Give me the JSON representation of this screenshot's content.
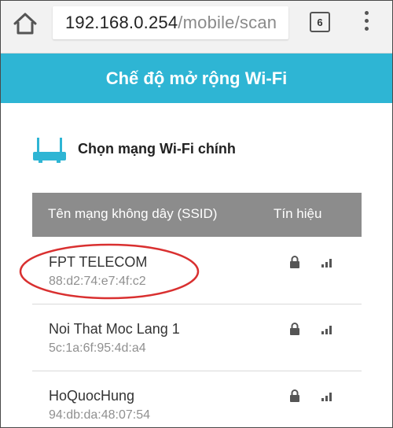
{
  "browser": {
    "url_host": "192.168.0.254",
    "url_path": "/mobile/scan",
    "tab_count": "6"
  },
  "header": {
    "title": "Chế độ mở rộng Wi-Fi"
  },
  "section": {
    "title": "Chọn mạng Wi-Fi chính"
  },
  "table": {
    "col_ssid": "Tên mạng không dây (SSID)",
    "col_signal": "Tín hiệu",
    "rows": [
      {
        "ssid": "FPT TELECOM",
        "mac": "88:d2:74:e7:4f:c2",
        "locked": true,
        "signal": 2
      },
      {
        "ssid": "Noi That Moc Lang 1",
        "mac": "5c:1a:6f:95:4d:a4",
        "locked": true,
        "signal": 2
      },
      {
        "ssid": "HoQuocHung",
        "mac": "94:db:da:48:07:54",
        "locked": true,
        "signal": 2
      }
    ]
  },
  "colors": {
    "header_bg": "#2eb5d4",
    "table_header_bg": "#8c8c8c",
    "highlight": "#d93030"
  },
  "icons": [
    "home-icon",
    "tabs-icon",
    "menu-icon",
    "router-icon",
    "lock-icon",
    "signal-icon"
  ]
}
